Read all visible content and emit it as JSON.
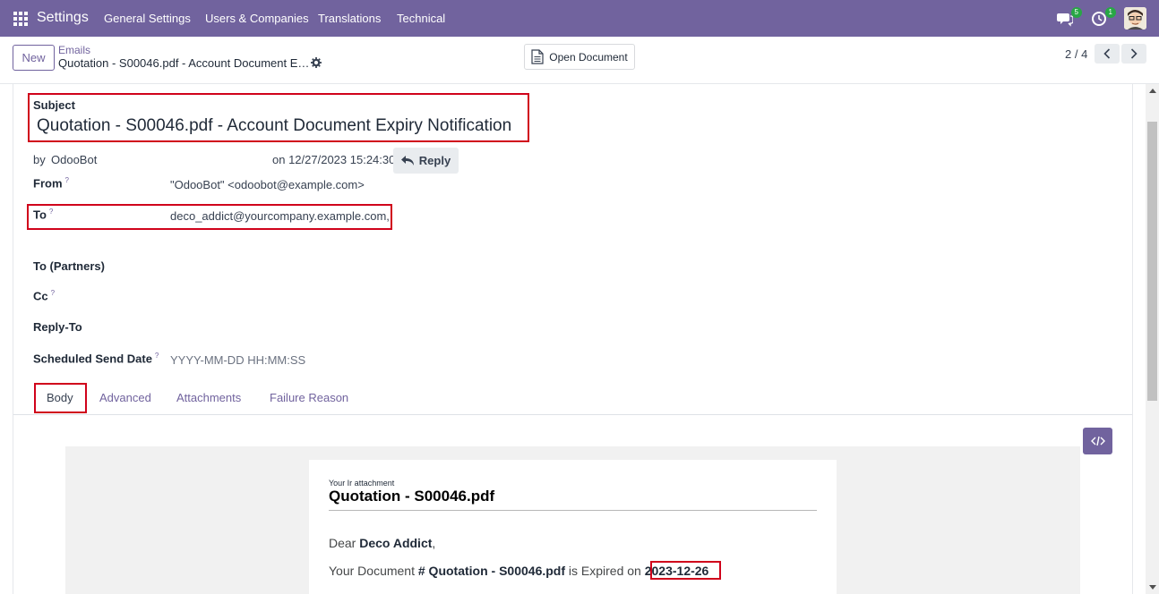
{
  "navbar": {
    "brand": "Settings",
    "menu": [
      "General Settings",
      "Users & Companies",
      "Translations",
      "Technical"
    ],
    "messages_count": "5",
    "activities_count": "1"
  },
  "control_panel": {
    "new_label": "New",
    "breadcrumb_parent": "Emails",
    "breadcrumb_current": "Quotation - S00046.pdf - Account Document E…",
    "open_document_label": "Open Document",
    "pager": "2 / 4"
  },
  "form": {
    "subject_label": "Subject",
    "subject_value": "Quotation - S00046.pdf - Account Document Expiry Notification",
    "by_label": "by",
    "by_value": "OdooBot",
    "on_date": "on 12/27/2023 15:24:30",
    "reply_label": "Reply",
    "fields": {
      "from_label": "From",
      "from_value": "\"OdooBot\" <odoobot@example.com>",
      "to_label": "To",
      "to_value": "deco_addict@yourcompany.example.com,",
      "to_partners_label": "To (Partners)",
      "cc_label": "Cc",
      "reply_to_label": "Reply-To",
      "scheduled_label": "Scheduled Send Date",
      "scheduled_placeholder": "YYYY-MM-DD HH:MM:SS"
    },
    "help_mark": "?"
  },
  "tabs": [
    "Body",
    "Advanced",
    "Attachments",
    "Failure Reason"
  ],
  "body": {
    "small_header": "Your Ir attachment",
    "title": "Quotation - S00046.pdf",
    "dear_prefix": "Dear ",
    "dear_name": "Deco Addict",
    "dear_suffix": ",",
    "doc_prefix": "Your Document ",
    "doc_hash": "# Quotation - S00046.pdf",
    "doc_middle": " is Expired on ",
    "doc_date": "2023-12-26"
  },
  "colors": {
    "brand": "#71639e",
    "highlight": "#d0021b"
  }
}
